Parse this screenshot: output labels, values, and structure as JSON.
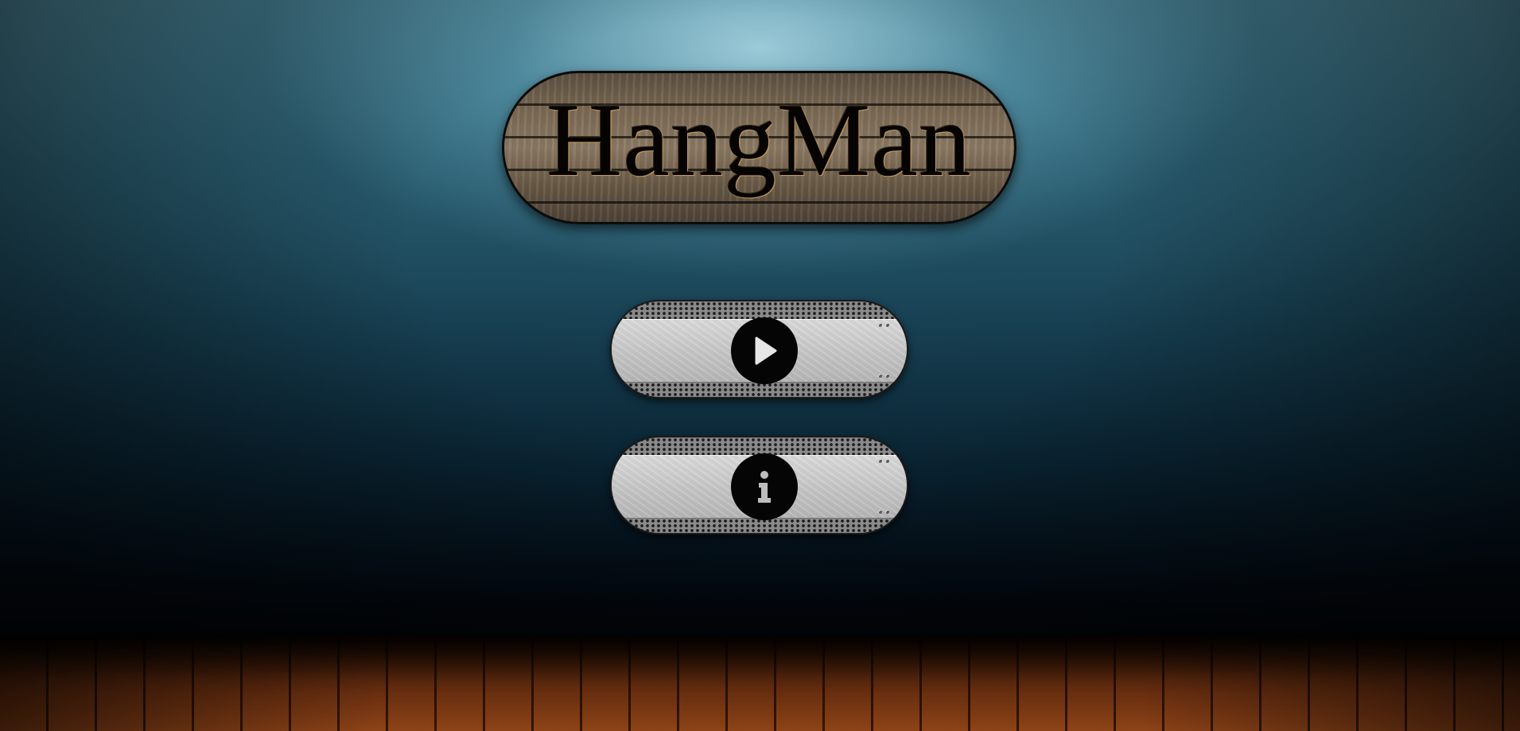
{
  "title": {
    "text": "HangMan"
  },
  "menu": {
    "play_button": {
      "icon": "play-icon"
    },
    "info_button": {
      "icon": "info-icon"
    }
  },
  "colors": {
    "wall_top": "#4e8a9d",
    "wall_bottom": "#030a12",
    "floor": "#7a3612",
    "plank_wood": "#7c6a55",
    "title_text": "#050403",
    "button_metal": "#c9c9c9",
    "icon_circle": "#050505"
  }
}
